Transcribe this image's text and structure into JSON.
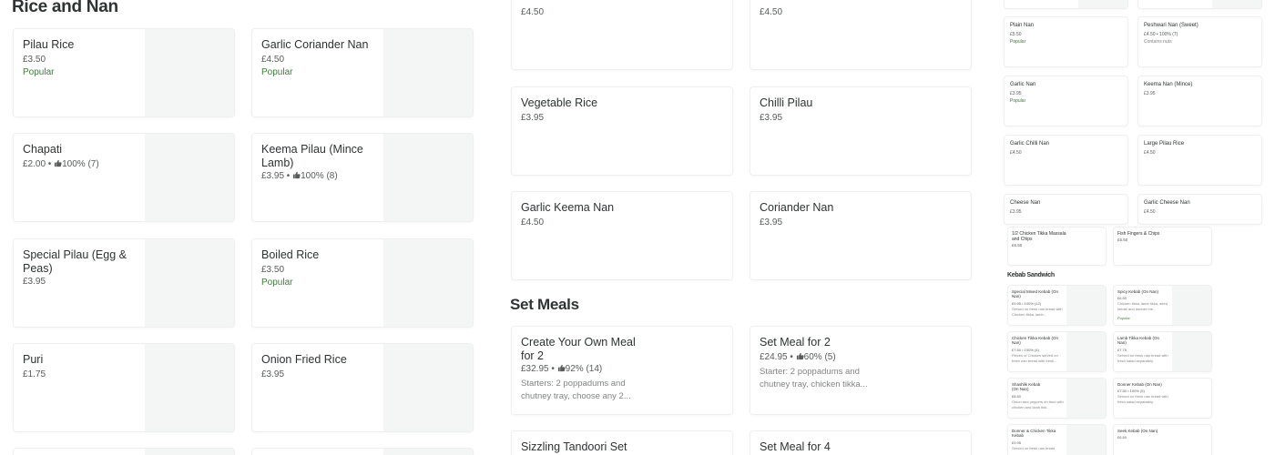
{
  "left": {
    "heading": "Rice and Nan",
    "col_a": [
      {
        "name": "Pilau Rice",
        "price": "£3.50",
        "tag": "Popular"
      },
      {
        "name": "Chapati",
        "price": "£2.00 •",
        "rating": "100% (7)"
      },
      {
        "name": "Special Pilau (Egg & Peas)",
        "price": "£3.95"
      },
      {
        "name": "Puri",
        "price": "£1.75"
      }
    ],
    "col_b": [
      {
        "name": "Garlic Coriander Nan",
        "price": "£4.50",
        "tag": "Popular"
      },
      {
        "name": "Keema Pilau (Mince Lamb)",
        "price": "£3.95 •",
        "rating": "100% (8)"
      },
      {
        "name": "Boiled Rice",
        "price": "£3.50",
        "tag": "Popular"
      },
      {
        "name": "Onion Fried Rice",
        "price": "£3.95"
      }
    ]
  },
  "middle": {
    "top_prices": [
      "£4.50",
      "£4.50"
    ],
    "rows": [
      [
        {
          "name": "Vegetable Rice",
          "price": "£3.95"
        },
        {
          "name": "Chilli Pilau",
          "price": "£3.95"
        }
      ],
      [
        {
          "name": "Garlic Keema Nan",
          "price": "£4.50"
        },
        {
          "name": "Coriander Nan",
          "price": "£3.95"
        }
      ]
    ],
    "set_meals_heading": "Set Meals",
    "meals": [
      {
        "name": "Create Your Own Meal for 2",
        "price": "£32.95 •",
        "rating": "92% (14)",
        "desc": "Starters: 2 poppadums and chutney tray, choose any 2..."
      },
      {
        "name": "Set Meal for 2",
        "price": "£24.95 •",
        "rating": "60% (5)",
        "desc": "Starter: 2 poppadums and chutney tray, chicken tikka..."
      }
    ],
    "bottom": [
      {
        "name": "Sizzling Tandoori Set"
      },
      {
        "name": "Set Meal for 4"
      }
    ]
  },
  "right": {
    "grid": [
      [
        {
          "name": "Plain Nan",
          "price": "£5.50",
          "tag": "Popular"
        },
        {
          "name": "Peshwari Nan (Sweet)",
          "price": "£4.50 • 100% (7)",
          "note": "Contains nuts"
        }
      ],
      [
        {
          "name": "Garlic Nan",
          "price": "£3.95",
          "tag": "Popular"
        },
        {
          "name": "Keema Nan (Mince)",
          "price": "£3.95"
        }
      ],
      [
        {
          "name": "Garlic Chilli Nan",
          "price": "£4.50"
        },
        {
          "name": "Large Pilau Rice",
          "price": "£4.50"
        }
      ],
      [
        {
          "name": "Cheese Nan",
          "price": "£3.95"
        },
        {
          "name": "Garlic Cheese Nan",
          "price": "£4.50"
        }
      ]
    ],
    "row5": [
      {
        "name": "1/2 Chicken Tikka Massala and Chips",
        "price": "£6.50"
      },
      {
        "name": "Fish Fingers & Chips",
        "price": "£5.50"
      }
    ],
    "kebab_heading": "Kebab Sandwich",
    "kebabs": [
      [
        {
          "name": "Special Mixed Kebab (On Nan)",
          "price": "£9.95 • 100% (12)",
          "desc": "Served on fresh nan bread with Chicken tikka, lamb..."
        },
        {
          "name": "Spicy Kebab (On Nan)",
          "price": "£6.50",
          "desc": "Chicken tikka, lamb tikka, seed kebab and donner me...",
          "tag": "Popular"
        }
      ],
      [
        {
          "name": "Chicken Tikka Kebab (On Nan)",
          "price": "£7.50 • 100% (4)",
          "desc": "Pieces of Chicken served on fresh nan bread with fresh..."
        },
        {
          "name": "Lamb Tikka Kebab (On Nan)",
          "price": "£7.75",
          "desc": "Served on fresh nan bread with fresh salad separately"
        }
      ],
      [
        {
          "name": "Shashlik Kebab (On Nan)",
          "price": "£8.50",
          "desc": "Onion and peppers on fried with chicken and lamb tikk..."
        },
        {
          "name": "Donner Kebab (On Nan)",
          "price": "£7.50 • 100% (5)",
          "desc": "Served on fresh nan bread with fresh salad separately"
        }
      ],
      [
        {
          "name": "Donner & Chicken Tikka Kebab",
          "price": "£9.95",
          "desc": "Served on fresh nan bread"
        },
        {
          "name": "Seek Kebab (On Nan)",
          "price": "£6.50"
        }
      ]
    ]
  }
}
